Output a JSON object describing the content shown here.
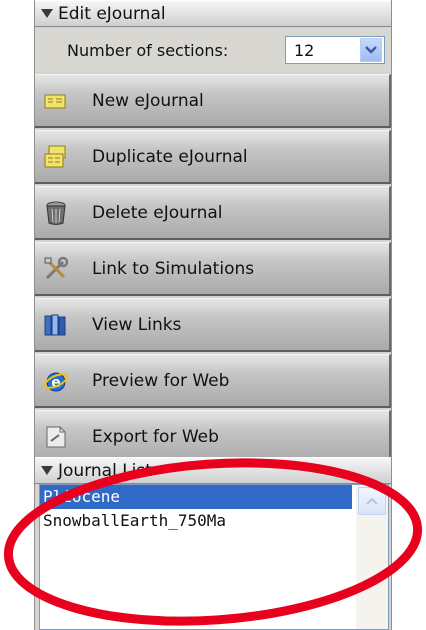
{
  "edit_section": {
    "title": "Edit eJournal"
  },
  "sections_control": {
    "label": "Number of sections:",
    "value": "12"
  },
  "buttons": [
    {
      "label": "New eJournal",
      "icon": "new-journal-icon"
    },
    {
      "label": "Duplicate eJournal",
      "icon": "duplicate-journal-icon"
    },
    {
      "label": "Delete eJournal",
      "icon": "trash-icon"
    },
    {
      "label": "Link to Simulations",
      "icon": "tools-icon"
    },
    {
      "label": "View Links",
      "icon": "books-icon"
    },
    {
      "label": "Preview for Web",
      "icon": "browser-icon"
    },
    {
      "label": "Export for Web",
      "icon": "export-icon"
    }
  ],
  "journal_section": {
    "title": "Journal List"
  },
  "journal_list": {
    "items": [
      "Pliocene",
      "SnowballEarth_750Ma"
    ],
    "selected_index": 0
  },
  "colors": {
    "selection": "#3169c6",
    "annotation_ring": "#e8001c"
  }
}
